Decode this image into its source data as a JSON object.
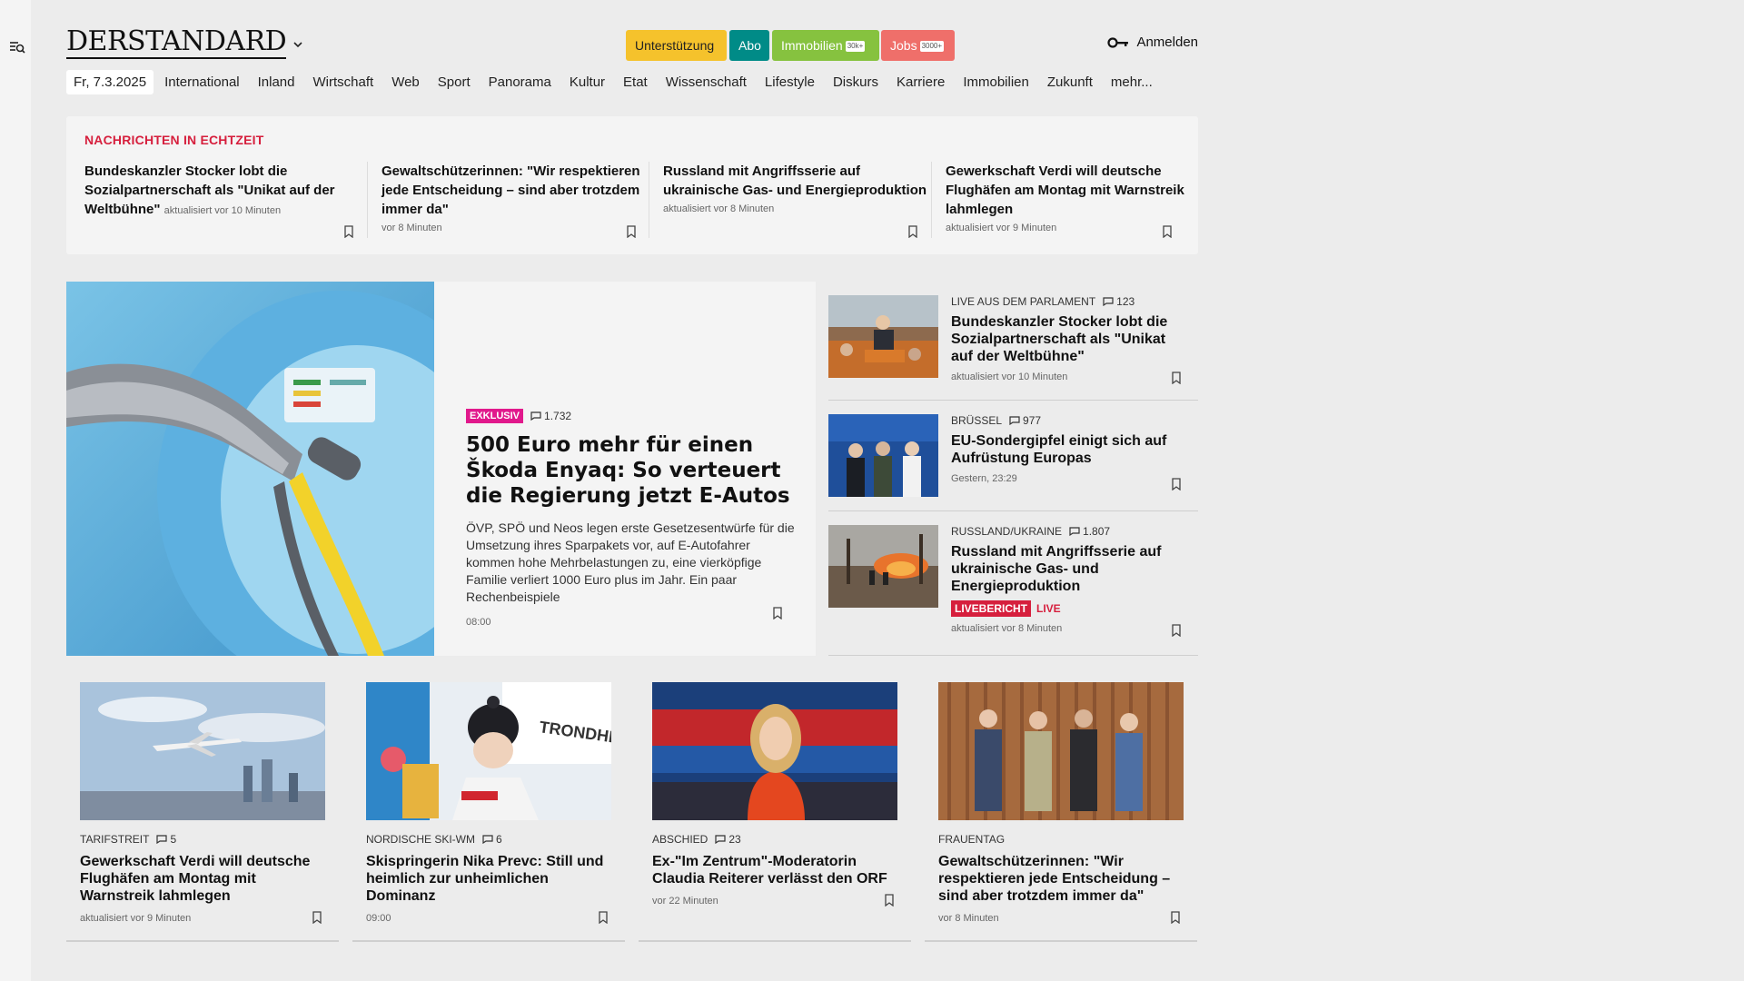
{
  "header": {
    "logo": "DERSTANDARD",
    "promos": {
      "unterstuetzung": "Unterstützung",
      "abo": "Abo",
      "immobilien": "Immobilien",
      "immobilien_badge": "30k+",
      "jobs": "Jobs",
      "jobs_badge": "3000+"
    },
    "login": "Anmelden"
  },
  "nav": {
    "date": "Fr, 7.3.2025",
    "items": [
      "International",
      "Inland",
      "Wirtschaft",
      "Web",
      "Sport",
      "Panorama",
      "Kultur",
      "Etat",
      "Wissenschaft",
      "Lifestyle",
      "Diskurs",
      "Karriere",
      "Immobilien",
      "Zukunft",
      "mehr..."
    ]
  },
  "ticker": {
    "title": "NACHRICHTEN IN ECHTZEIT",
    "items": [
      {
        "title": "Bundeskanzler Stocker lobt die Sozialpartnerschaft als \"Unikat auf der Weltbühne\"",
        "meta": "aktualisiert vor 10 Minuten"
      },
      {
        "title": "Gewaltschützerinnen: \"Wir respektieren jede Entscheidung – sind aber trotzdem immer da\"",
        "meta": "vor 8 Minuten"
      },
      {
        "title": "Russland mit Angriffsserie auf ukrainische Gas- und Energieproduktion",
        "meta": "aktualisiert vor 8 Minuten"
      },
      {
        "title": "Gewerkschaft Verdi will deutsche Flughäfen am Montag mit Warnstreik lahmlegen",
        "meta": "aktualisiert vor 9 Minuten"
      }
    ]
  },
  "lead": {
    "badge": "EXKLUSIV",
    "comments": "1.732",
    "title": "500 Euro mehr für einen Škoda Enyaq: So verteuert die Regierung jetzt E-Autos",
    "description": "ÖVP, SPÖ und Neos legen erste Gesetzesentwürfe für die Umsetzung ihres Sparpakets vor, auf E-Autofahrer kommen hohe Mehrbelastungen zu, eine vierköpfige Familie verliert 1000 Euro plus im Jahr. Ein paar Rechenbeispiele",
    "time": "08:00"
  },
  "side": [
    {
      "kicker": "LIVE AUS DEM PARLAMENT",
      "comments": "123",
      "title": "Bundeskanzler Stocker lobt die Sozialpartnerschaft als \"Unikat auf der Weltbühne\"",
      "meta": "aktualisiert vor 10 Minuten"
    },
    {
      "kicker": "BRÜSSEL",
      "comments": "977",
      "title": "EU-Sondergipfel einigt sich auf Aufrüstung Europas",
      "meta": "Gestern, 23:29"
    },
    {
      "kicker": "RUSSLAND/UKRAINE",
      "comments": "1.807",
      "title": "Russland mit Angriffsserie auf ukrainische Gas- und Energieproduktion",
      "live_badge": "LIVEBERICHT",
      "live_text": "LIVE",
      "meta": "aktualisiert vor 8 Minuten"
    }
  ],
  "cards": [
    {
      "kicker": "TARIFSTREIT",
      "comments": "5",
      "title": "Gewerkschaft Verdi will deutsche Flughäfen am Montag mit Warnstreik lahmlegen",
      "meta": "aktualisiert vor 9 Minuten"
    },
    {
      "kicker": "NORDISCHE SKI-WM",
      "comments": "6",
      "title": "Skispringerin Nika Prevc: Still und heimlich zur unheimlichen Dominanz",
      "meta": "09:00",
      "sign": "TRONDHEIM"
    },
    {
      "kicker": "ABSCHIED",
      "comments": "23",
      "title": "Ex-\"Im Zentrum\"-Moderatorin Claudia Reiterer verlässt den ORF",
      "meta": "vor 22 Minuten"
    },
    {
      "kicker": "FRAUENTAG",
      "comments": "",
      "title": "Gewaltschützerinnen: \"Wir respektieren jede Entscheidung – sind aber trotzdem immer da\"",
      "meta": "vor 8 Minuten"
    }
  ],
  "colors": {
    "accent_red": "#d61f3d",
    "exklusiv_pink": "#e1198c",
    "promo_yellow": "#f5c22c",
    "promo_teal": "#008b87",
    "promo_green": "#86c23f",
    "promo_coral": "#ef6f6a"
  }
}
